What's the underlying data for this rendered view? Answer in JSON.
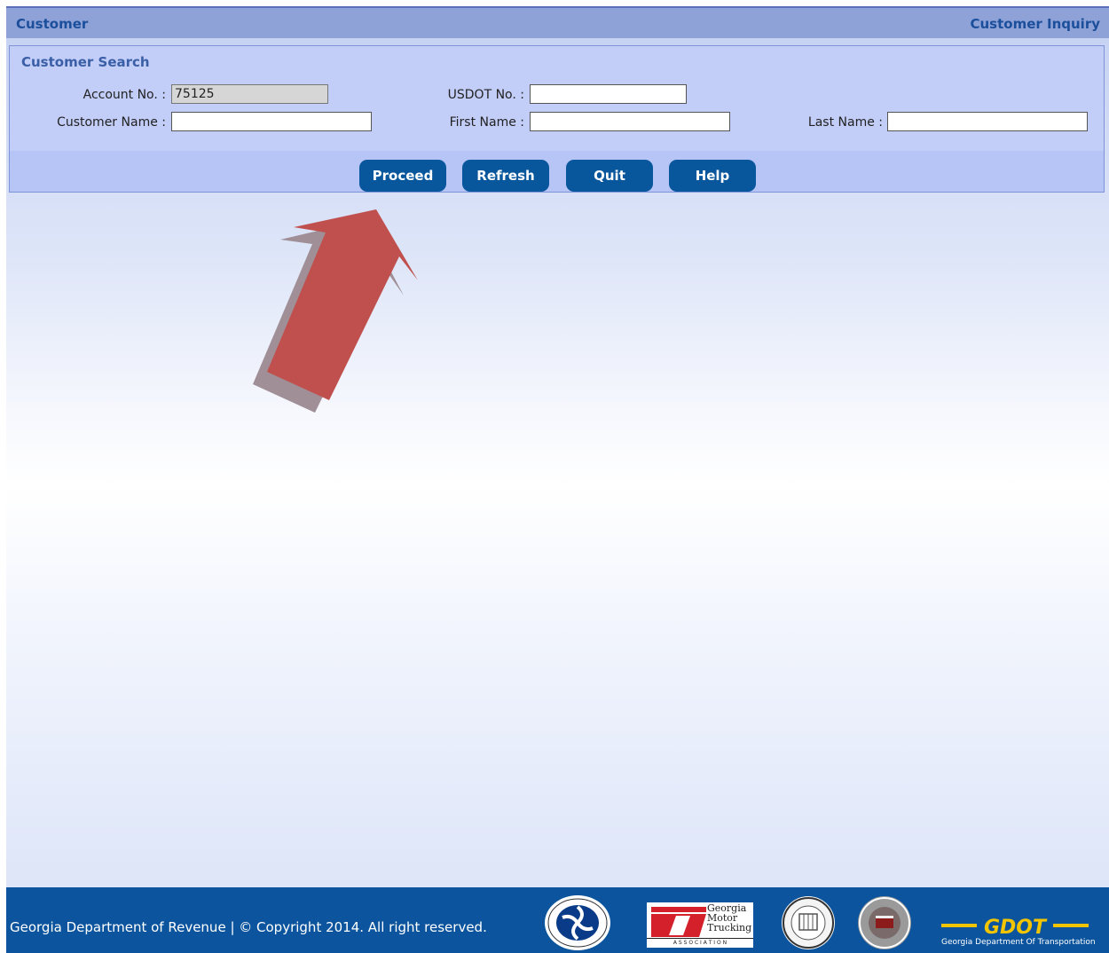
{
  "header": {
    "left_title": "Customer",
    "right_title": "Customer Inquiry"
  },
  "search": {
    "section_title": "Customer Search",
    "account_no": {
      "label": "Account No. :",
      "value": "75125"
    },
    "usdot_no": {
      "label": "USDOT No. :",
      "value": ""
    },
    "customer_name": {
      "label": "Customer Name :",
      "value": ""
    },
    "first_name": {
      "label": "First Name :",
      "value": ""
    },
    "last_name": {
      "label": "Last Name :",
      "value": ""
    }
  },
  "buttons": {
    "proceed": "Proceed",
    "refresh": "Refresh",
    "quit": "Quit",
    "help": "Help"
  },
  "footer": {
    "text": "Georgia Department of Revenue | © Copyright 2014. All right reserved.",
    "logos": {
      "usdot": "usdot-seal-icon",
      "gmta": {
        "line1": "Georgia",
        "line2": "Motor",
        "line3": "Trucking",
        "line4": "A S S O C I A T I O N"
      },
      "dept_seal": "department-seal-icon",
      "state_seal": "state-of-georgia-seal-icon",
      "gdot": {
        "mark": "GDOT",
        "caption": "Georgia Department Of Transportation"
      }
    }
  },
  "annotation": {
    "arrow_color": "#c0504d",
    "shadow_color": "#a08f96",
    "icon": "arrow-up-right-icon"
  },
  "colors": {
    "button": "#08569c",
    "footer": "#0c559e",
    "title_text": "#1c4f9b"
  }
}
